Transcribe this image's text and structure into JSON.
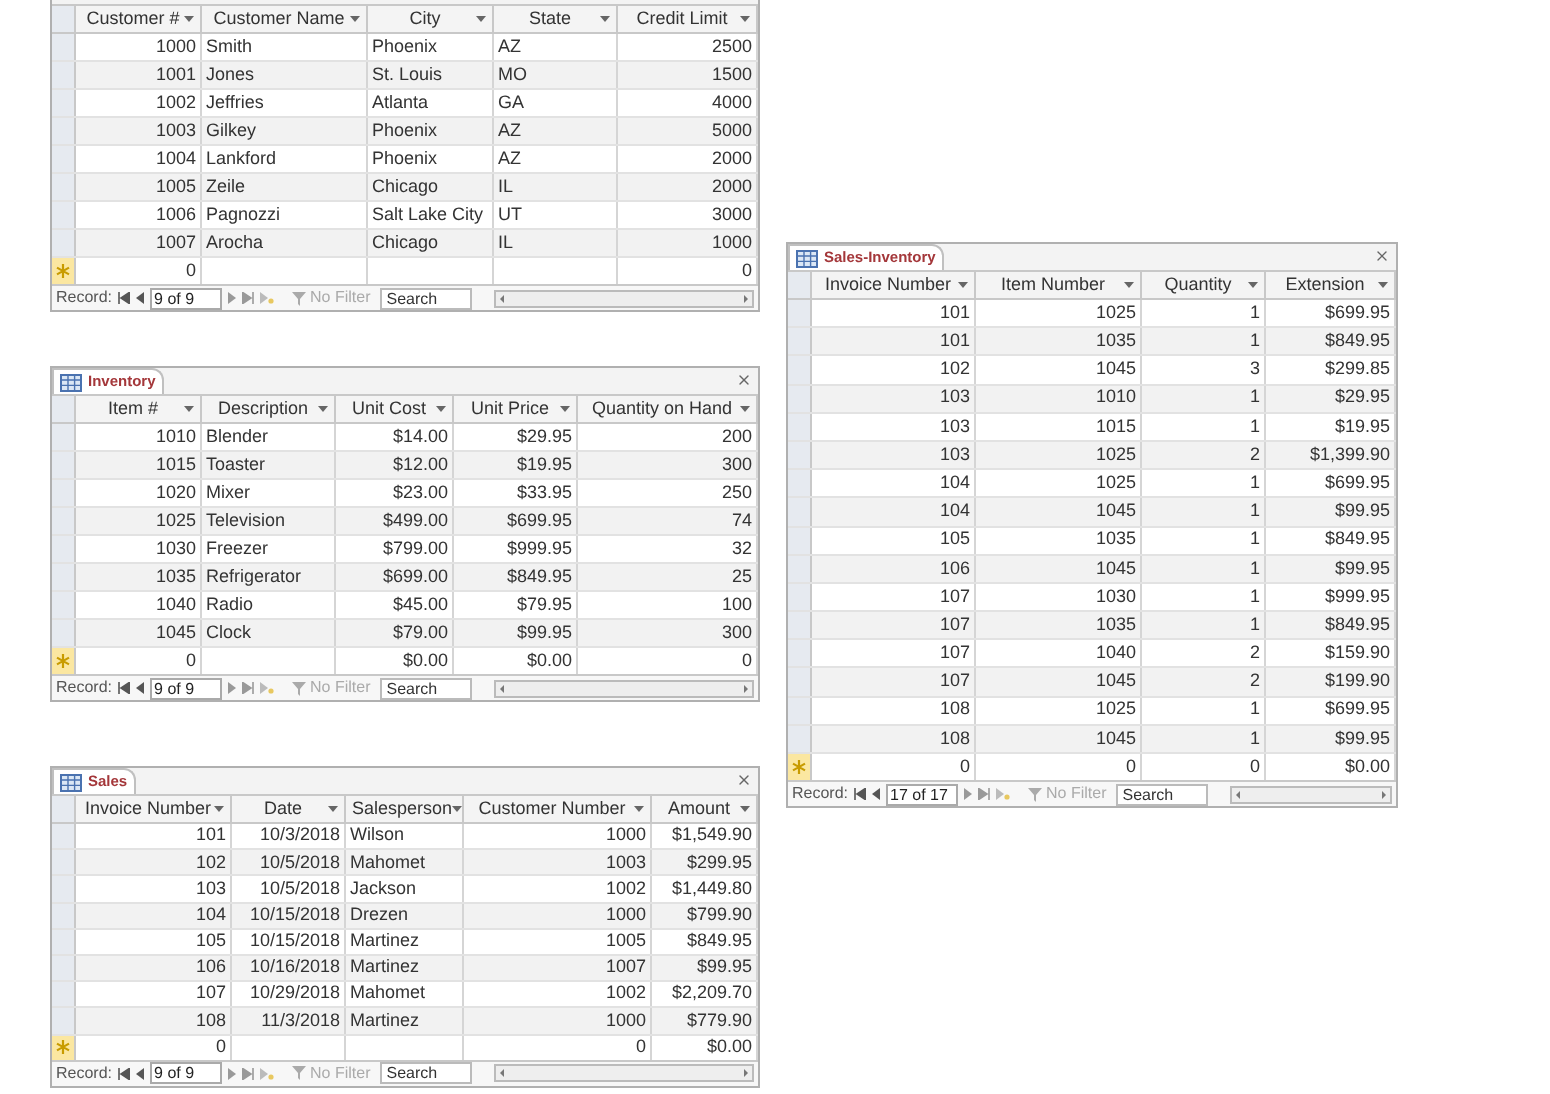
{
  "datasheets": [
    {
      "columns": [
        {
          "label": "Customer #",
          "kind": "number"
        },
        {
          "label": "Customer Name",
          "kind": "text"
        },
        {
          "label": "City",
          "kind": "text"
        },
        {
          "label": "State",
          "kind": "text"
        },
        {
          "label": "Credit Limit",
          "kind": "number"
        }
      ],
      "rows": [
        [
          "1000",
          "Smith",
          "Phoenix",
          "AZ",
          "2500"
        ],
        [
          "1001",
          "Jones",
          "St. Louis",
          "MO",
          "1500"
        ],
        [
          "1002",
          "Jeffries",
          "Atlanta",
          "GA",
          "4000"
        ],
        [
          "1003",
          "Gilkey",
          "Phoenix",
          "AZ",
          "5000"
        ],
        [
          "1004",
          "Lankford",
          "Phoenix",
          "AZ",
          "2000"
        ],
        [
          "1005",
          "Zeile",
          "Chicago",
          "IL",
          "2000"
        ],
        [
          "1006",
          "Pagnozzi",
          "Salt Lake City",
          "UT",
          "3000"
        ],
        [
          "1007",
          "Arocha",
          "Chicago",
          "IL",
          "1000"
        ]
      ],
      "new_row": {
        "0": "0",
        "4": "0"
      },
      "navigation": {
        "label": "Record:",
        "position": "9 of 9",
        "filter": "No Filter",
        "search": "Search"
      }
    },
    {
      "title": "Inventory",
      "columns": [
        {
          "label": "Item #",
          "kind": "number"
        },
        {
          "label": "Description",
          "kind": "text"
        },
        {
          "label": "Unit Cost",
          "kind": "number"
        },
        {
          "label": "Unit Price",
          "kind": "number"
        },
        {
          "label": "Quantity on Hand",
          "kind": "number"
        }
      ],
      "rows": [
        [
          "1010",
          "Blender",
          "$14.00",
          "$29.95",
          "200"
        ],
        [
          "1015",
          "Toaster",
          "$12.00",
          "$19.95",
          "300"
        ],
        [
          "1020",
          "Mixer",
          "$23.00",
          "$33.95",
          "250"
        ],
        [
          "1025",
          "Television",
          "$499.00",
          "$699.95",
          "74"
        ],
        [
          "1030",
          "Freezer",
          "$799.00",
          "$999.95",
          "32"
        ],
        [
          "1035",
          "Refrigerator",
          "$699.00",
          "$849.95",
          "25"
        ],
        [
          "1040",
          "Radio",
          "$45.00",
          "$79.95",
          "100"
        ],
        [
          "1045",
          "Clock",
          "$79.00",
          "$99.95",
          "300"
        ]
      ],
      "new_row": {
        "0": "0",
        "2": "$0.00",
        "3": "$0.00",
        "4": "0"
      },
      "navigation": {
        "label": "Record:",
        "position": "9 of 9",
        "filter": "No Filter",
        "search": "Search"
      }
    },
    {
      "title": "Sales-Inventory",
      "columns": [
        {
          "label": "Invoice Number",
          "kind": "number"
        },
        {
          "label": "Item Number",
          "kind": "number"
        },
        {
          "label": "Quantity",
          "kind": "number"
        },
        {
          "label": "Extension",
          "kind": "number"
        }
      ],
      "rows": [
        [
          "101",
          "1025",
          "1",
          "$699.95"
        ],
        [
          "101",
          "1035",
          "1",
          "$849.95"
        ],
        [
          "102",
          "1045",
          "3",
          "$299.85"
        ],
        [
          "103",
          "1010",
          "1",
          "$29.95"
        ],
        [
          "103",
          "1015",
          "1",
          "$19.95"
        ],
        [
          "103",
          "1025",
          "2",
          "$1,399.90"
        ],
        [
          "104",
          "1025",
          "1",
          "$699.95"
        ],
        [
          "104",
          "1045",
          "1",
          "$99.95"
        ],
        [
          "105",
          "1035",
          "1",
          "$849.95"
        ],
        [
          "106",
          "1045",
          "1",
          "$99.95"
        ],
        [
          "107",
          "1030",
          "1",
          "$999.95"
        ],
        [
          "107",
          "1035",
          "1",
          "$849.95"
        ],
        [
          "107",
          "1040",
          "2",
          "$159.90"
        ],
        [
          "107",
          "1045",
          "2",
          "$199.90"
        ],
        [
          "108",
          "1025",
          "1",
          "$699.95"
        ],
        [
          "108",
          "1045",
          "1",
          "$99.95"
        ]
      ],
      "new_row": {
        "0": "0",
        "1": "0",
        "2": "0",
        "3": "$0.00"
      },
      "navigation": {
        "label": "Record:",
        "position": "17 of 17",
        "filter": "No Filter",
        "search": "Search"
      }
    },
    {
      "title": "Sales",
      "columns": [
        {
          "label": "Invoice Number",
          "kind": "number"
        },
        {
          "label": "Date",
          "kind": "number"
        },
        {
          "label": "Salesperson",
          "kind": "text"
        },
        {
          "label": "Customer Number",
          "kind": "number"
        },
        {
          "label": "Amount",
          "kind": "number"
        }
      ],
      "rows": [
        [
          "101",
          "10/3/2018",
          "Wilson",
          "1000",
          "$1,549.90"
        ],
        [
          "102",
          "10/5/2018",
          "Mahomet",
          "1003",
          "$299.95"
        ],
        [
          "103",
          "10/5/2018",
          "Jackson",
          "1002",
          "$1,449.80"
        ],
        [
          "104",
          "10/15/2018",
          "Drezen",
          "1000",
          "$799.90"
        ],
        [
          "105",
          "10/15/2018",
          "Martinez",
          "1005",
          "$849.95"
        ],
        [
          "106",
          "10/16/2018",
          "Martinez",
          "1007",
          "$99.95"
        ],
        [
          "107",
          "10/29/2018",
          "Mahomet",
          "1002",
          "$2,209.70"
        ],
        [
          "108",
          "11/3/2018",
          "Martinez",
          "1000",
          "$779.90"
        ]
      ],
      "new_row": {
        "0": "0",
        "3": "0",
        "4": "$0.00"
      },
      "navigation": {
        "label": "Record:",
        "position": "9 of 9",
        "filter": "No Filter",
        "search": "Search"
      }
    }
  ]
}
